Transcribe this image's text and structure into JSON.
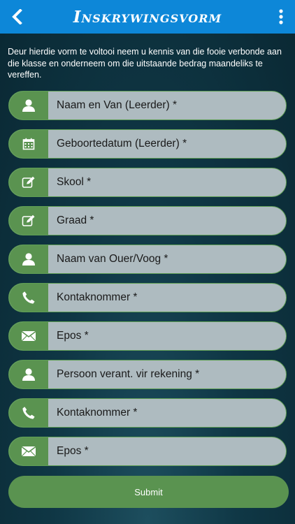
{
  "header": {
    "title": "Inskrywingsvorm",
    "back_icon": "chevron-left-icon",
    "menu_icon": "more-vertical-icon"
  },
  "intro_text": "Deur hierdie vorm te voltooi neem u kennis van die fooie verbonde aan die klasse en onderneem om die uitstaande bedrag maandeliks te vereffen.",
  "fields": [
    {
      "label": "Naam en Van (Leerder) *",
      "icon": "user-icon"
    },
    {
      "label": "Geboortedatum (Leerder) *",
      "icon": "calendar-icon"
    },
    {
      "label": "Skool *",
      "icon": "edit-icon"
    },
    {
      "label": "Graad *",
      "icon": "edit-icon"
    },
    {
      "label": "Naam van Ouer/Voog *",
      "icon": "user-icon"
    },
    {
      "label": "Kontaknommer *",
      "icon": "phone-icon"
    },
    {
      "label": "Epos *",
      "icon": "envelope-icon"
    },
    {
      "label": "Persoon verant. vir rekening *",
      "icon": "user-icon"
    },
    {
      "label": "Kontaknommer *",
      "icon": "phone-icon"
    },
    {
      "label": "Epos *",
      "icon": "envelope-icon"
    }
  ],
  "submit_label": "Submit",
  "colors": {
    "header": "#0d87d8",
    "accent_green": "#5a9350",
    "field_bg": "#aebbc0",
    "background": "#0f3745"
  }
}
